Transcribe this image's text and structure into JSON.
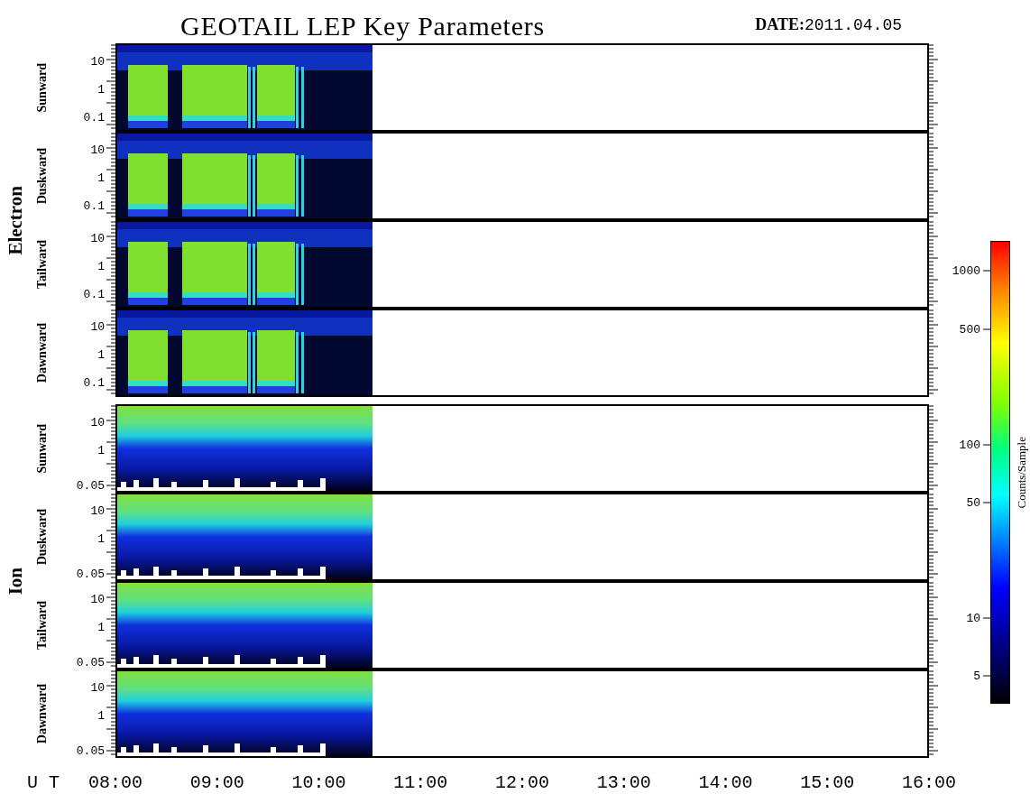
{
  "title": "GEOTAIL LEP Key Parameters",
  "date": {
    "label": "DATE:",
    "value": "2011.04.05"
  },
  "groups": [
    {
      "name": "Electron",
      "kind": "electron",
      "panels": [
        {
          "direction": "Sunward",
          "yticks": [
            "10",
            "1",
            "0.1"
          ]
        },
        {
          "direction": "Duskward",
          "yticks": [
            "10",
            "1",
            "0.1"
          ]
        },
        {
          "direction": "Tailward",
          "yticks": [
            "10",
            "1",
            "0.1"
          ]
        },
        {
          "direction": "Dawnward",
          "yticks": [
            "10",
            "1",
            "0.1"
          ]
        }
      ]
    },
    {
      "name": "Ion",
      "kind": "ion",
      "panels": [
        {
          "direction": "Sunward",
          "yticks": [
            "10",
            "1",
            "0.05"
          ]
        },
        {
          "direction": "Duskward",
          "yticks": [
            "10",
            "1",
            "0.05"
          ]
        },
        {
          "direction": "Tailward",
          "yticks": [
            "10",
            "1",
            "0.05"
          ]
        },
        {
          "direction": "Dawnward",
          "yticks": [
            "10",
            "1",
            "0.05"
          ]
        }
      ]
    }
  ],
  "x_axis": {
    "label": "U T",
    "ticks": [
      "08:00",
      "09:00",
      "10:00",
      "11:00",
      "12:00",
      "13:00",
      "14:00",
      "15:00",
      "16:00"
    ]
  },
  "colorbar": {
    "label": "Counts/Sample",
    "ticks": [
      "1000",
      "500",
      "100",
      "50",
      "10",
      "5"
    ]
  }
}
